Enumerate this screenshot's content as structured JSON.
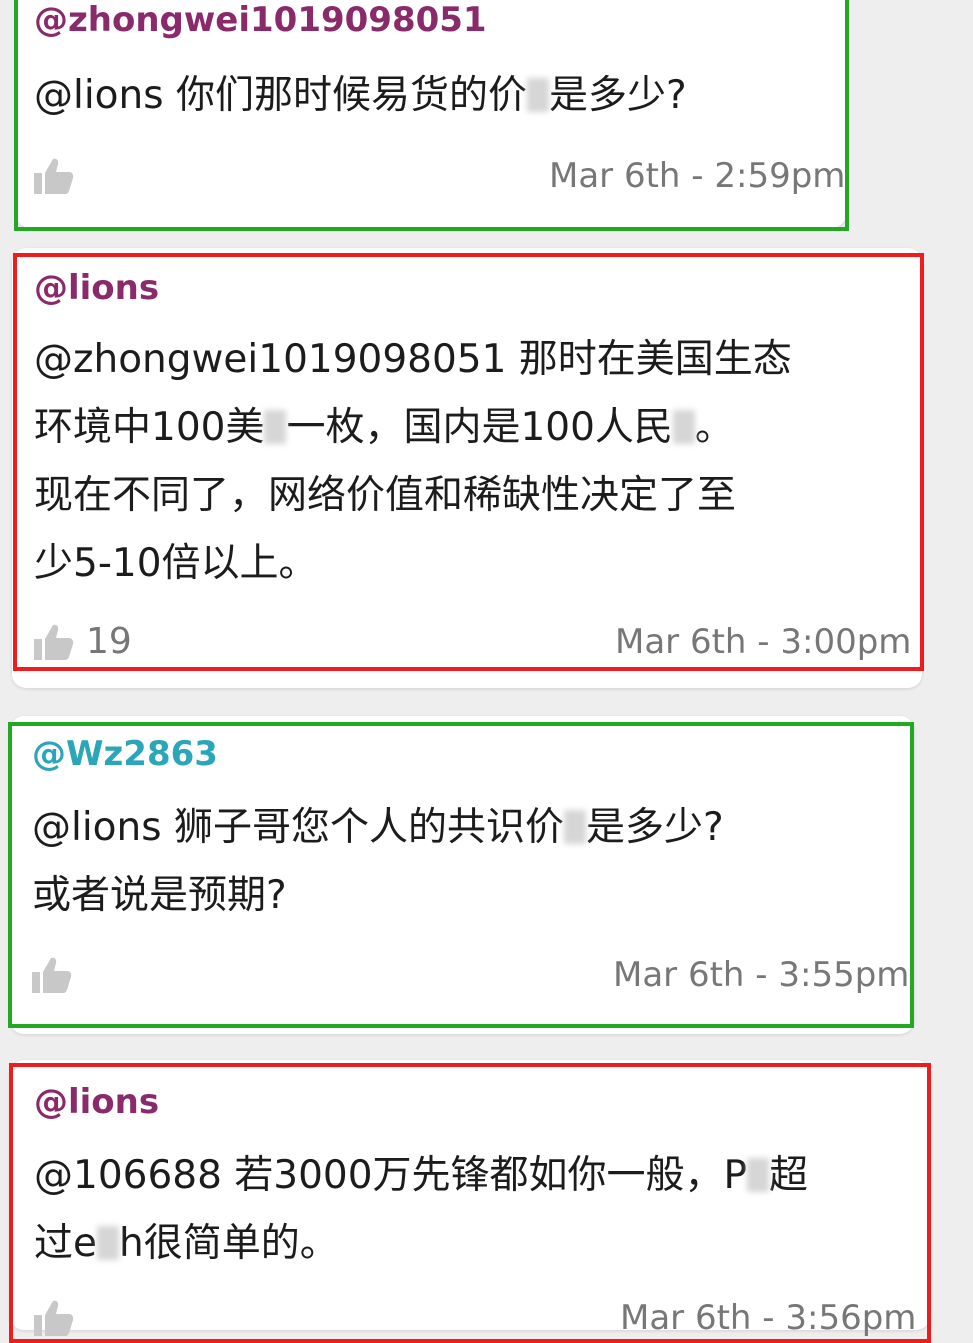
{
  "colors": {
    "username_purple": "#8a2a6a",
    "username_teal": "#2aa6b8",
    "frame_green": "#22a822",
    "frame_red": "#ee1c1c",
    "timestamp_gray": "#777777",
    "icon_gray": "#c8c8c8"
  },
  "comments": [
    {
      "username": "@zhongwei1019098051",
      "text": "@lions 你们那时候易货的价格是多少?",
      "likes": "",
      "timestamp": "Mar 6th - 2:59pm",
      "frame": "green"
    },
    {
      "username": "@lions",
      "text": "@zhongwei1019098051 那时在美国生态环境中100美金一枚，国内是100人民币。现在不同了，网络价值和稀缺性决定了至少5-10倍以上。",
      "likes": "19",
      "timestamp": "Mar 6th - 3:00pm",
      "frame": "red"
    },
    {
      "username": "@Wz2863",
      "text": "@lions 狮子哥您个人的共识价格是多少?或者说是预期?",
      "likes": "",
      "timestamp": "Mar 6th - 3:55pm",
      "frame": "green"
    },
    {
      "username": "@lions",
      "text": "@106688 若3000万先锋都如你一般，Pi超过eth很简单的。",
      "likes": "",
      "timestamp": "Mar 6th - 3:56pm",
      "frame": "red"
    }
  ],
  "icons": {
    "like": "thumbs-up-icon"
  }
}
